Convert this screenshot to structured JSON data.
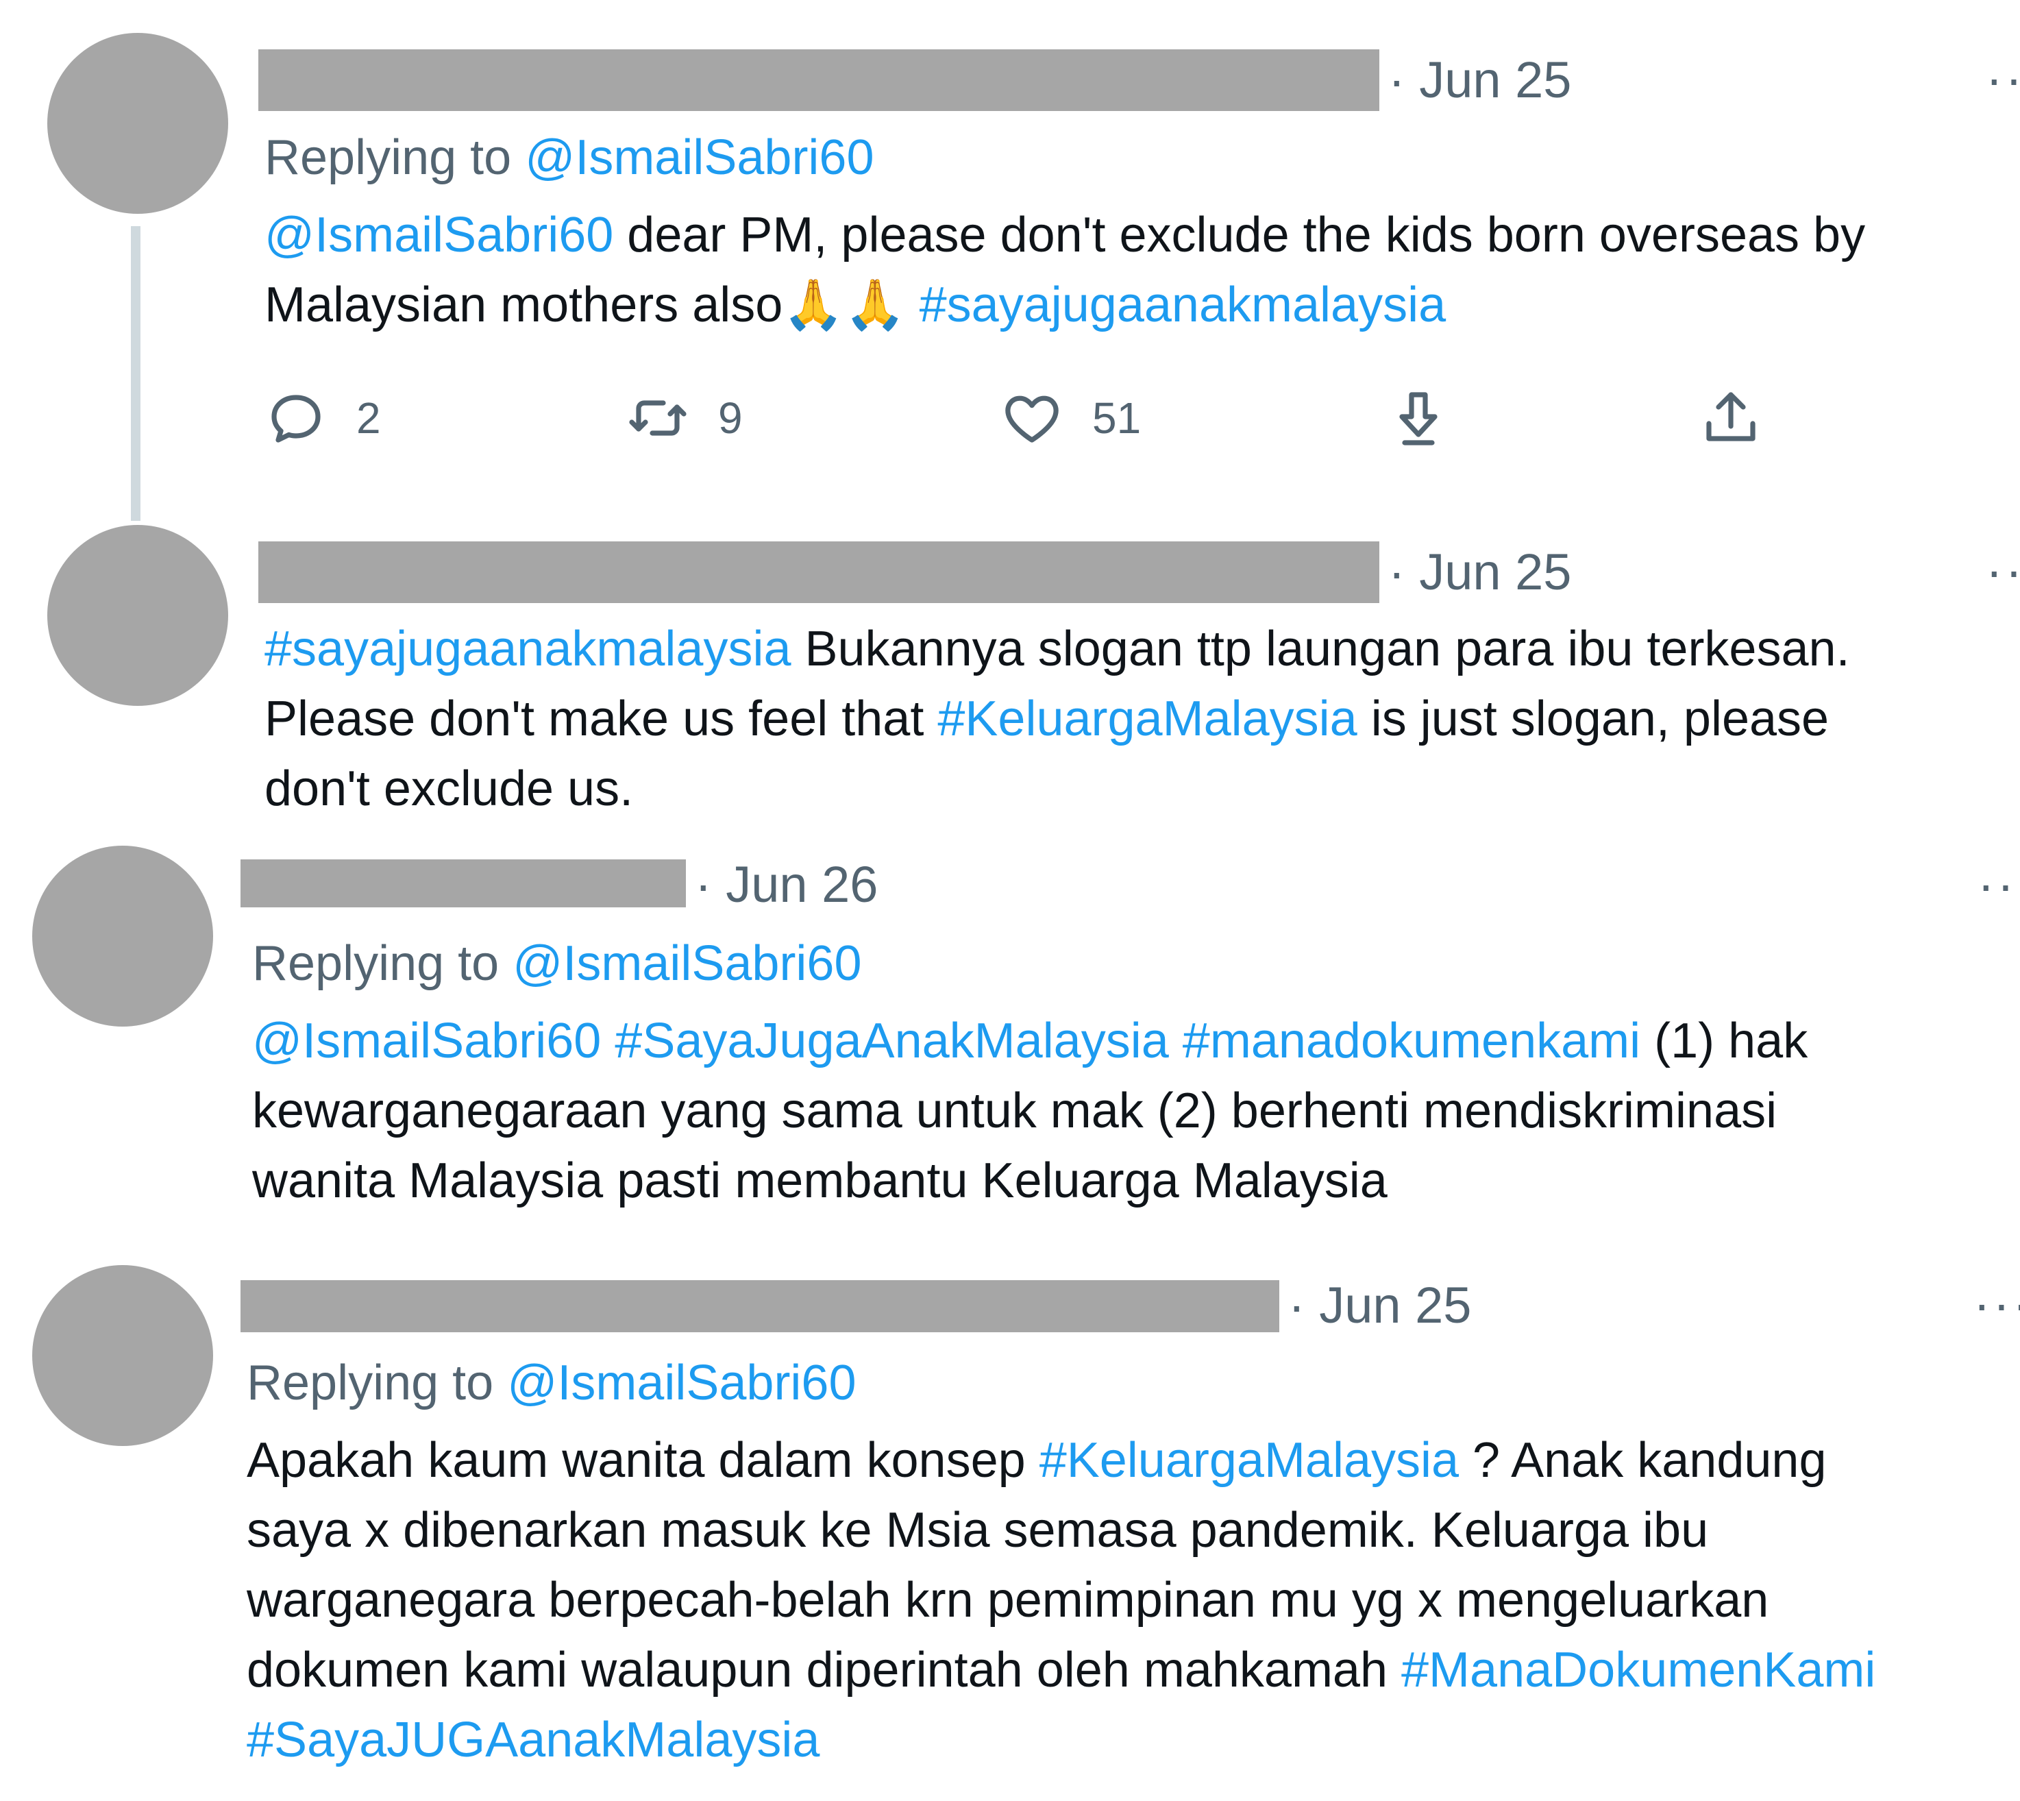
{
  "colors": {
    "link": "#1d9bf0",
    "text": "#0f1419",
    "muted": "#536471",
    "redaction": "#a6a6a6",
    "thread_line": "#cfd9de"
  },
  "tweets": [
    {
      "date": "· Jun 25",
      "more": "··",
      "replying_prefix": "Replying to",
      "replying_handle": "@IsmailSabri60",
      "line1_link": "@IsmailSabri60",
      "line1_text": " dear PM, please don't exclude the kids born overseas by",
      "line2_text": "Malaysian mothers also",
      "line2_emoji": "🙏🙏",
      "line2_link": " #sayajugaanakmalaysia",
      "actions": {
        "reply_icon": "reply-icon",
        "reply_count": "2",
        "retweet_icon": "retweet-icon",
        "retweet_count": "9",
        "like_icon": "heart-icon",
        "like_count": "51",
        "download_icon": "download-icon",
        "share_icon": "share-icon"
      }
    },
    {
      "date": "· Jun 25",
      "more": "··",
      "line1_link": "#sayajugaanakmalaysia",
      "line1_text": " Bukannya slogan ttp laungan para ibu terkesan.",
      "line2_text": "Please don't make us feel that ",
      "line2_link": "#KeluargaMalaysia",
      "line2_text2": " is just slogan, please",
      "line3_text": "don't exclude us."
    },
    {
      "date": "· Jun 26",
      "more": "··",
      "replying_prefix": "Replying to",
      "replying_handle": "@IsmailSabri60",
      "line1_link": "@IsmailSabri60 #SayaJugaAnakMalaysia #manadokumenkami",
      "line1_text": " (1) hak",
      "line2_text": "kewarganegaraan yang sama untuk mak (2) berhenti mendiskriminasi",
      "line3_text": "wanita Malaysia pasti membantu Keluarga Malaysia"
    },
    {
      "date": "· Jun 25",
      "more": "···",
      "replying_prefix": "Replying to",
      "replying_handle": "@IsmailSabri60",
      "line1_text": "Apakah kaum wanita dalam konsep ",
      "line1_link": "#KeluargaMalaysia",
      "line1_text2": " ? Anak kandung",
      "line2_text": "saya x dibenarkan masuk ke Msia semasa pandemik. Keluarga ibu",
      "line3_text": "warganegara berpecah-belah krn pemimpinan mu yg x mengeluarkan",
      "line4_text": "dokumen kami walaupun diperintah oleh mahkamah ",
      "line4_link": "#ManaDokumenKami",
      "line5_link": "#SayaJUGAanakMalaysia"
    }
  ]
}
